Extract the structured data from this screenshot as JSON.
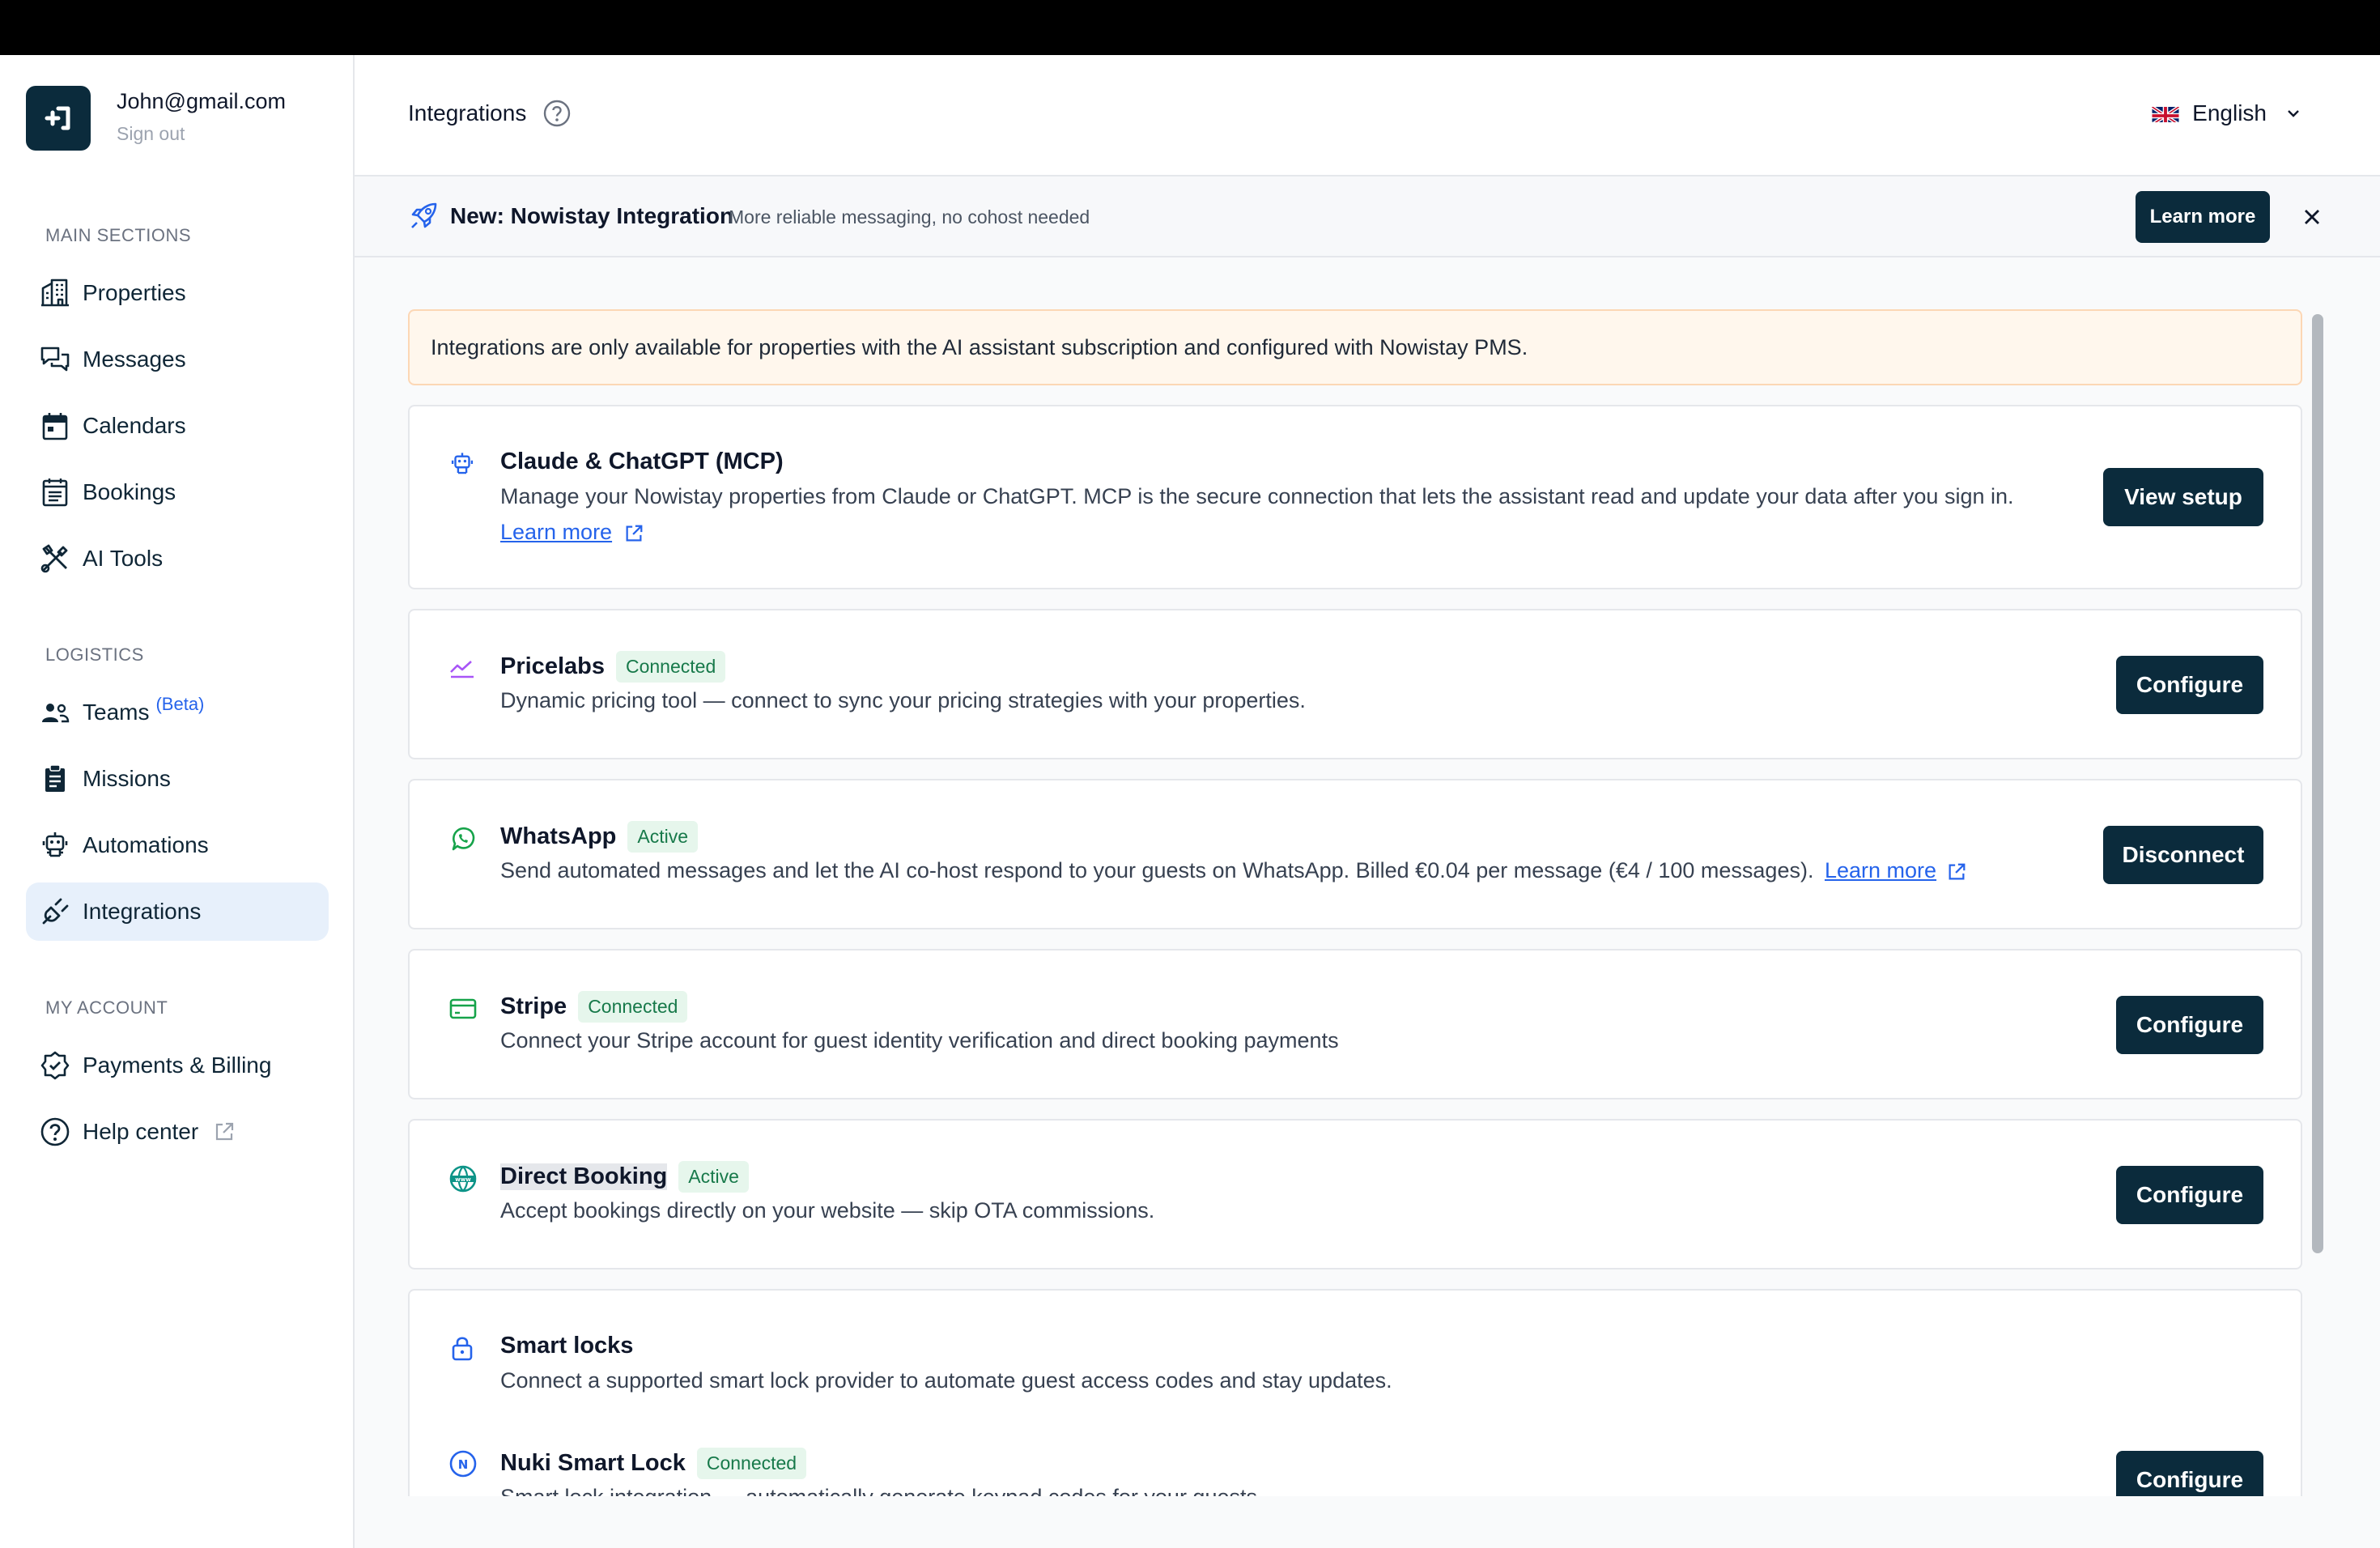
{
  "sidebar": {
    "user_email": "John@gmail.com",
    "sign_out": "Sign out",
    "main_sections_label": "MAIN SECTIONS",
    "main_items": [
      {
        "label": "Properties",
        "icon": "building-icon"
      },
      {
        "label": "Messages",
        "icon": "chat-icon"
      },
      {
        "label": "Calendars",
        "icon": "calendar-icon"
      },
      {
        "label": "Bookings",
        "icon": "list-icon"
      },
      {
        "label": "AI Tools",
        "icon": "tools-icon"
      }
    ],
    "logistics_label": "LOGISTICS",
    "logistics_items": [
      {
        "label": "Teams",
        "badge": "(Beta)",
        "icon": "team-icon"
      },
      {
        "label": "Missions",
        "icon": "clipboard-icon"
      },
      {
        "label": "Automations",
        "icon": "robot-icon"
      },
      {
        "label": "Integrations",
        "icon": "plug-icon",
        "active": true
      }
    ],
    "account_label": "MY ACCOUNT",
    "account_items": [
      {
        "label": "Payments & Billing",
        "icon": "badge-check-icon"
      },
      {
        "label": "Help center",
        "icon": "question-icon"
      }
    ]
  },
  "header": {
    "title": "Integrations",
    "language": "English"
  },
  "banner": {
    "title": "New: Nowistay Integration",
    "subtitle": "More reliable messaging, no cohost needed",
    "button": "Learn more"
  },
  "alert": "Integrations are only available for properties with the AI assistant subscription and configured with Nowistay PMS.",
  "integrations": [
    {
      "name": "Claude & ChatGPT (MCP)",
      "description": "Manage your Nowistay properties from Claude or ChatGPT. MCP is the secure connection that lets the assistant read and update your data after you sign in.",
      "link": "Learn more",
      "button": "View setup"
    },
    {
      "name": "Pricelabs",
      "badge": "Connected",
      "description": "Dynamic pricing tool — connect to sync your pricing strategies with your properties.",
      "button": "Configure"
    },
    {
      "name": "WhatsApp",
      "badge": "Active",
      "description": "Send automated messages and let the AI co-host respond to your guests on WhatsApp. Billed €0.04 per message (€4 / 100 messages).",
      "link": "Learn more",
      "button": "Disconnect"
    },
    {
      "name": "Stripe",
      "badge": "Connected",
      "description": "Connect your Stripe account for guest identity verification and direct booking payments",
      "button": "Configure"
    },
    {
      "name": "Direct Booking",
      "badge": "Active",
      "description": "Accept bookings directly on your website — skip OTA commissions.",
      "button": "Configure"
    },
    {
      "name": "Smart locks",
      "description": "Connect a supported smart lock provider to automate guest access codes and stay updates.",
      "sub": {
        "name": "Nuki Smart Lock",
        "badge": "Connected",
        "description": "Smart lock integration — automatically generate keypad codes for your guests",
        "button": "Configure"
      }
    }
  ],
  "colors": {
    "primary": "#0b2b3c",
    "active_nav": "#e7f0fb",
    "badge_bg": "#e6f6ec",
    "badge_text": "#17794a",
    "link": "#2563eb",
    "alert_bg": "#fff7ed"
  }
}
